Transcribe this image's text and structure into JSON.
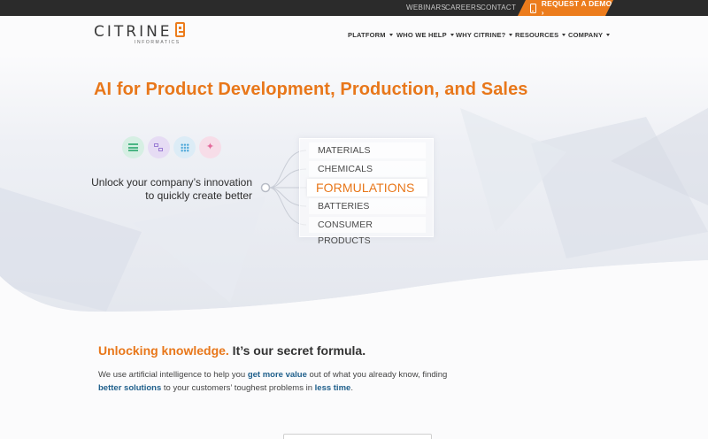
{
  "topbar": {
    "links": [
      "WEBINARS",
      "CAREERS",
      "CONTACT"
    ],
    "demo_label": "REQUEST A DEMO ›",
    "demo_icon": "phone-icon",
    "accent": "#ec7c1c"
  },
  "logo": {
    "word": "CITRINE",
    "sub": "INFORMATICS"
  },
  "nav": {
    "items": [
      "PLATFORM",
      "WHO WE HELP",
      "WHY CITRINE?",
      "RESOURCES",
      "COMPANY"
    ]
  },
  "hero": {
    "headline": "AI for Product Development, Production, and Sales",
    "tagline_line1": "Unlock your company’s innovation",
    "tagline_line2": "to quickly create better",
    "icons": [
      "database-icon",
      "workflow-icon",
      "grid-dots-icon",
      "sparkle-icon"
    ],
    "options": [
      "MATERIALS",
      "CHEMICALS",
      "FORMULATIONS",
      "BATTERIES",
      "CONSUMER PRODUCTS"
    ],
    "active_option": "FORMULATIONS"
  },
  "section": {
    "title_highlight": "Unlocking knowledge.",
    "title_rest": " It’s our secret formula.",
    "para": {
      "t1": "We use artificial intelligence to help you ",
      "b1": "get more value",
      "t2": " out of what you already know, finding ",
      "b2": "better solutions",
      "t3": " to your customers’ toughest problems in ",
      "b3": "less time",
      "t4": "."
    }
  }
}
